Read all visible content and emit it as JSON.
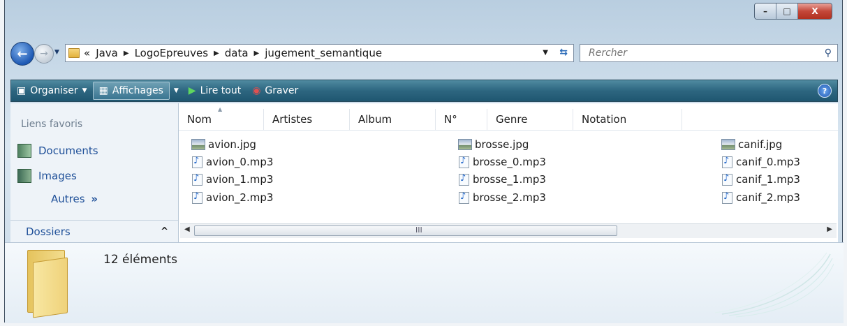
{
  "window": {
    "buttons": {
      "minimize": "–",
      "maximize": "□",
      "close": "X"
    }
  },
  "nav": {
    "breadcrumb_prefix": "«",
    "breadcrumbs": [
      "Java",
      "LogoEpreuves",
      "data",
      "jugement_semantique"
    ],
    "search_placeholder": "Rercher"
  },
  "toolbar": {
    "organize": "Organiser",
    "views": "Affichages",
    "play_all": "Lire tout",
    "burn": "Graver",
    "help": "?"
  },
  "sidebar": {
    "favorites_title": "Liens favoris",
    "favorites": [
      "Documents",
      "Images"
    ],
    "others": "Autres",
    "others_glyph": "»",
    "folders": "Dossiers",
    "folders_glyph": "^"
  },
  "columns": [
    "Nom",
    "Artistes",
    "Album",
    "N°",
    "Genre",
    "Notation"
  ],
  "files": [
    [
      "avion.jpg",
      "avion_0.mp3",
      "avion_1.mp3",
      "avion_2.mp3"
    ],
    [
      "brosse.jpg",
      "brosse_0.mp3",
      "brosse_1.mp3",
      "brosse_2.mp3"
    ],
    [
      "canif.jpg",
      "canif_0.mp3",
      "canif_1.mp3",
      "canif_2.mp3"
    ]
  ],
  "scroll_grip": "III",
  "details": {
    "count": "12 éléments"
  },
  "colors": {
    "toolbar": "#2d6680",
    "link": "#1e4f98",
    "close": "#c4483a"
  }
}
